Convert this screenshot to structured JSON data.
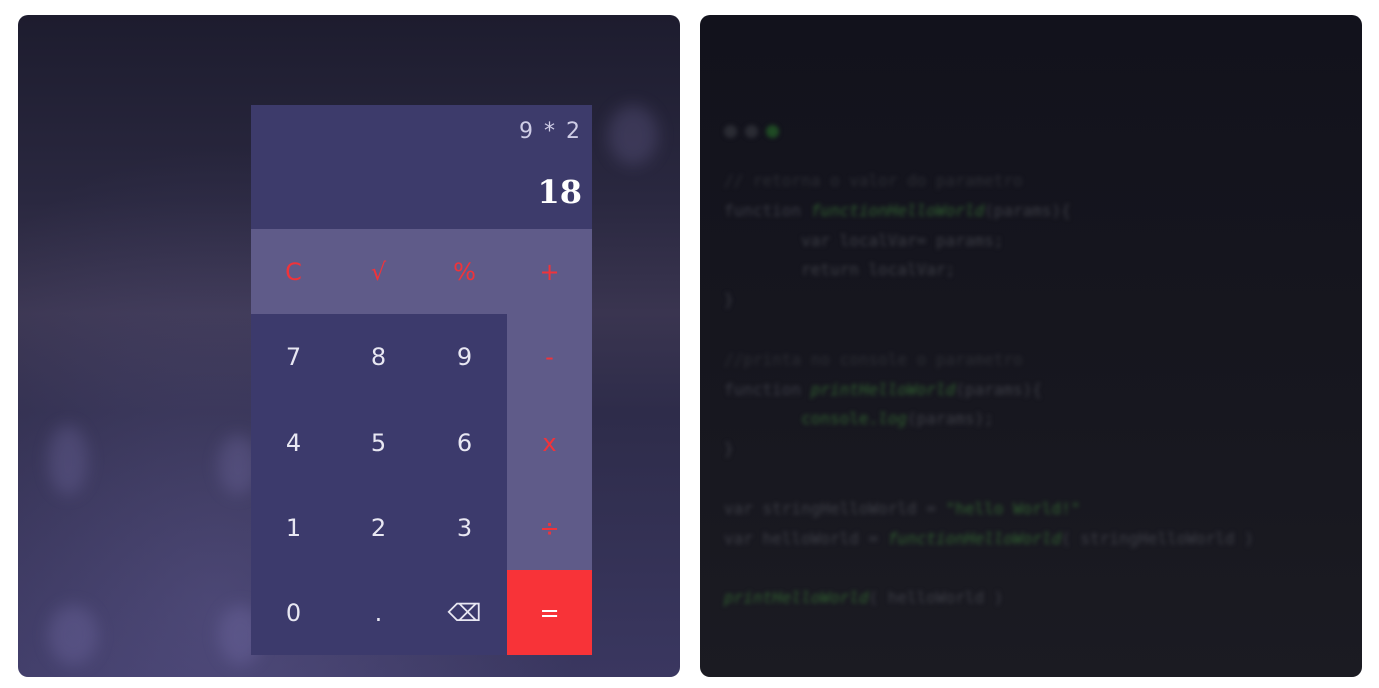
{
  "calculator": {
    "expression": "9 * 2",
    "result": "18",
    "keys": {
      "clear": "C",
      "sqrt": "√",
      "percent": "%",
      "plus": "+",
      "seven": "7",
      "eight": "8",
      "nine": "9",
      "minus": "-",
      "four": "4",
      "five": "5",
      "six": "6",
      "multiply": "x",
      "one": "1",
      "two": "2",
      "three": "3",
      "divide": "÷",
      "zero": "0",
      "dot": ".",
      "backspace": "⌫",
      "equals": "="
    },
    "colors": {
      "display": "#3d3b6b",
      "operator_keys": "#5f5b89",
      "number_keys": "#3c3a6c",
      "accent_red": "#f83338"
    }
  },
  "code": {
    "line1": "// retorna o valor do parametro",
    "line2_kw": "function ",
    "line2_fn": "functionHelloWorld",
    "line2_rest": "(params){",
    "line3": "        var localVar= params;",
    "line4": "        return localVar;",
    "line5": "}",
    "line7": "//printa no console o parametro",
    "line8_kw": "function ",
    "line8_fn": "printHelloWorld",
    "line8_rest": "(params){",
    "line9_a": "        console.",
    "line9_fn": "log",
    "line9_b": "(params);",
    "line10": "}",
    "line12_a": "var stringHelloWorld = ",
    "line12_str": "\"hello World!\"",
    "line13_a": "var helloWorld = ",
    "line13_fn": "functionHelloWorld",
    "line13_b": "( stringHelloWorld )",
    "line15_fn": "printHelloWorld",
    "line15_b": "( helloWorld )",
    "dot_colors": [
      "#2a2b33",
      "#2a2b33",
      "#1f4a24"
    ]
  }
}
